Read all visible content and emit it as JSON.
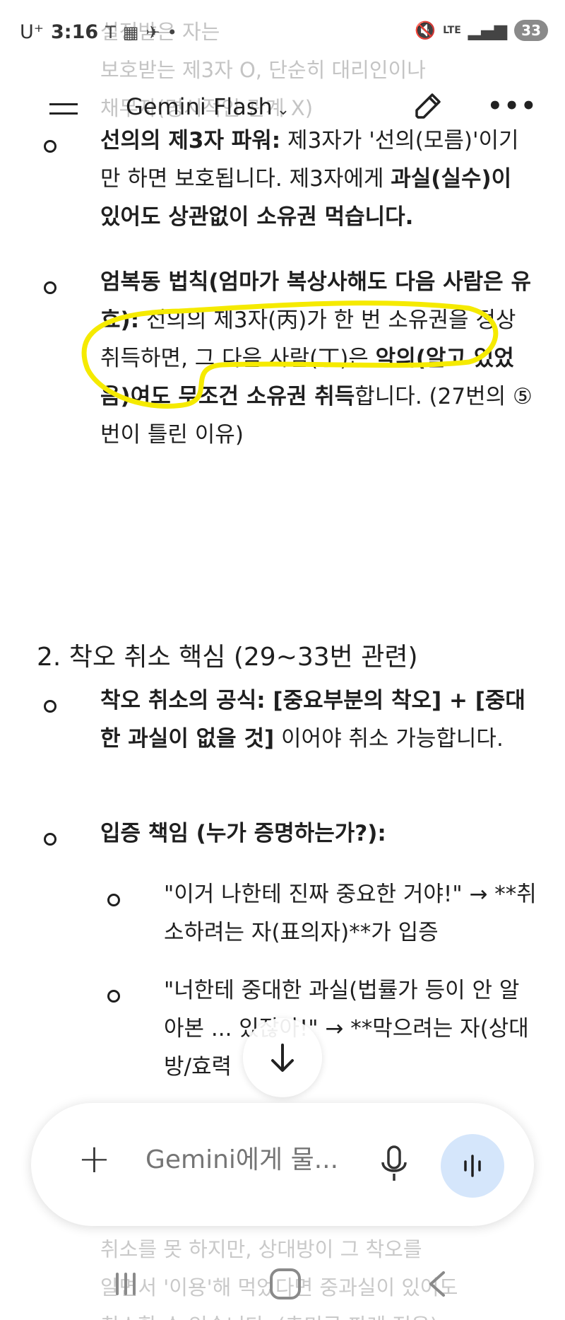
{
  "status_bar": {
    "carrier": "U⁺",
    "time": "3:16",
    "battery": "33",
    "network": "LTE"
  },
  "header": {
    "model_label": "Gemini Flash",
    "faded_lines": [
      "설정받은 자는",
      "보호받는 제3자 O, 단순히 대리인이나",
      "채무자(명시적인 관계 X)"
    ]
  },
  "content": {
    "items": [
      {
        "segments": [
          {
            "text": "선의의 제3자 파워:",
            "bold": true
          },
          {
            "text": " 제3자가 '선의(모름)'이기만 하면 보호됩니다. 제3자에게 ",
            "bold": false
          },
          {
            "text": "과실(실수)이 있어도 상관없이 소유권 먹습니다.",
            "bold": true
          }
        ]
      },
      {
        "segments": [
          {
            "text": "엄복동 법칙(엄마가 복상사해도 다음 사람은 유효):",
            "bold": true
          },
          {
            "text": " 선의의 제3자(丙)가 한 번 소유권을 정상 취득하면, 그 다음 사람(丁)은 ",
            "bold": false
          },
          {
            "text": "악의(알고 있었음)여도 무조건 소유권 취득",
            "bold": true
          },
          {
            "text": "합니다. (27번의 ⑤번이 틀린 이유)",
            "bold": false
          }
        ]
      }
    ],
    "section2_title": "2. 착오 취소 핵심 (29~33번 관련)",
    "section2_items": [
      {
        "segments": [
          {
            "text": "착오 취소의 공식: [중요부분의 착오] + [중대한 과실이 없을 것]",
            "bold": true
          },
          {
            "text": " 이어야 취소 가능합니다.",
            "bold": false
          }
        ]
      },
      {
        "segments": [
          {
            "text": "입증 책임 (누가 증명하는가?):",
            "bold": true
          }
        ]
      }
    ],
    "sub_items": [
      "\"이거 나한테 진짜 중요한 거야!\" → **취소하려는 자(표의자)**가 입증",
      "\"너한테 중대한 과실(법률가 등이 안 알아본 ... 있잖아!\" → **막으려는 자(상대방/효력"
    ],
    "bottom_faded_lines": [
      "취소를 못 하지만, 상대방이 그 착오를",
      "알면서 '이용'해 먹었다면 중과실이 있어도",
      "취소할 수 있습니다. (추미루 판례 적용)"
    ]
  },
  "input_bar": {
    "placeholder": "Gemini에게 물..."
  },
  "colors": {
    "highlight": "#f5ea00",
    "voice_button_bg": "#d5e6fb",
    "text": "#1f1f1f"
  },
  "icons": [
    "hamburger-icon",
    "chevron-down-icon",
    "edit-icon",
    "more-icon",
    "arrow-down-icon",
    "plus-icon",
    "mic-icon",
    "voice-wave-icon",
    "nav-recent-icon",
    "nav-home-icon",
    "nav-back-icon"
  ]
}
